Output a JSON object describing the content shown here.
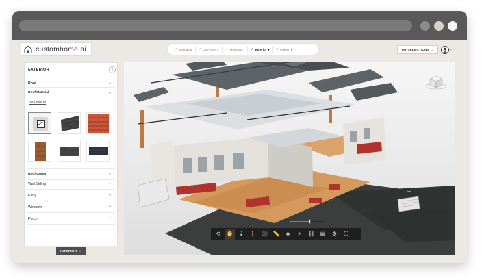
{
  "header": {
    "logo_text": "customhome.ai",
    "steps": [
      {
        "label": "Bungalow",
        "active": false,
        "dropdown": false
      },
      {
        "label": "One Story...",
        "active": false,
        "dropdown": false
      },
      {
        "label": "Three Be...",
        "active": false,
        "dropdown": false
      },
      {
        "label": "Exterior",
        "active": true,
        "dropdown": true
      },
      {
        "label": "Interior",
        "active": false,
        "dropdown": true
      }
    ],
    "check_glyph": "✓",
    "caret_glyph": "▾",
    "my_selections_label": "MY SELECTIONS →",
    "user_icon": "user-circle-icon"
  },
  "panel": {
    "title": "EXTERIOR",
    "collapse_glyph": "‹",
    "roof_label": "Roof",
    "roof_material_label": "Roof Material",
    "subtab_label": "Roof Material",
    "chevron_up": "˄",
    "chevron_down": "˅",
    "swatches": [
      {
        "name": "selected-default",
        "color": "#d6d6d6"
      },
      {
        "name": "dark-slate-shingle",
        "color": "#3c3c3c"
      },
      {
        "name": "red-clay-tile",
        "color": "#c9553a"
      },
      {
        "name": "wood-shake",
        "color": "#9a5c32"
      },
      {
        "name": "charcoal-shingle",
        "color": "#464646"
      },
      {
        "name": "black-asphalt",
        "color": "#2b2f36"
      }
    ],
    "selected_mark": "✓",
    "sections": [
      {
        "label": "Roof Gutter",
        "bold": true
      },
      {
        "label": "Wall Siding",
        "bold": false
      },
      {
        "label": "Entry",
        "bold": false
      },
      {
        "label": "Windows",
        "bold": false
      },
      {
        "label": "Porch",
        "bold": false
      }
    ],
    "interior_button_label": "INTERIOR →"
  },
  "viewer": {
    "slider_value": 0.6,
    "tools": [
      {
        "name": "orbit-icon",
        "glyph": "⟲",
        "active": false
      },
      {
        "name": "pan-hand-icon",
        "glyph": "✋",
        "active": true
      },
      {
        "name": "zoom-icon",
        "glyph": "⇣",
        "active": false
      },
      {
        "name": "walk-icon",
        "glyph": "🚶",
        "active": false
      },
      {
        "name": "camera-icon",
        "glyph": "🎥",
        "active": false
      },
      {
        "name": "measure-icon",
        "glyph": "📏",
        "active": false
      },
      {
        "name": "section-icon",
        "glyph": "◈",
        "active": false
      },
      {
        "name": "explode-icon",
        "glyph": "✦",
        "active": false
      },
      {
        "name": "model-tree-icon",
        "glyph": "⛓",
        "active": false
      },
      {
        "name": "properties-icon",
        "glyph": "▤",
        "active": false
      },
      {
        "name": "settings-icon",
        "glyph": "⚙",
        "active": false
      },
      {
        "name": "fullscreen-icon",
        "glyph": "⛶",
        "active": false
      }
    ]
  },
  "colors": {
    "titlebar": "#595959",
    "panel_bg": "#ffffff",
    "toolbar_bg": "#1f1f1f",
    "accent_blue": "#3c8fe0",
    "floor_dark": "#3b3e3c",
    "floor_wood": "#d49a5d",
    "brick": "#b0342c",
    "roof_slate": "#5e6368",
    "wall_light": "#eceae6"
  }
}
